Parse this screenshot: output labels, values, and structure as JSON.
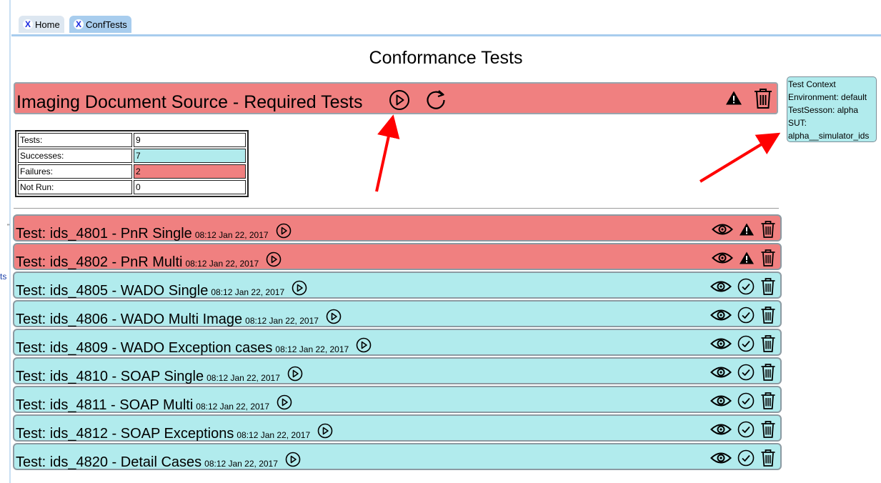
{
  "edge": {
    "mark1": "\"",
    "mark2": "ts"
  },
  "tabs": [
    {
      "label": "Home",
      "close": "X"
    },
    {
      "label": "ConfTests",
      "close": "X"
    }
  ],
  "page_title": "Conformance Tests",
  "suite": {
    "title": "Imaging Document Source - Required Tests",
    "status": "fail"
  },
  "context": {
    "title": "Test Context",
    "environment": "Environment: default",
    "session": "TestSesson: alpha",
    "sut_label": "SUT:",
    "sut_value": "alpha__simulator_ids"
  },
  "stats": {
    "tests_label": "Tests:",
    "tests": "9",
    "successes_label": "Successes:",
    "successes": "7",
    "failures_label": "Failures:",
    "failures": "2",
    "notrun_label": "Not Run:",
    "notrun": "0"
  },
  "colors": {
    "fail": "#f08080",
    "pass": "#b1ebed",
    "accent": "#a8cdee",
    "arrow": "#ff0000"
  },
  "tests": [
    {
      "title": "Test: ids_4801 - PnR Single",
      "time": "08:12 Jan 22, 2017",
      "status": "fail",
      "status_icon": "warning-icon"
    },
    {
      "title": "Test: ids_4802 - PnR Multi",
      "time": "08:12 Jan 22, 2017",
      "status": "fail",
      "status_icon": "warning-icon"
    },
    {
      "title": "Test: ids_4805 - WADO Single",
      "time": "08:12 Jan 22, 2017",
      "status": "pass",
      "status_icon": "check-circle-icon"
    },
    {
      "title": "Test: ids_4806 - WADO Multi Image",
      "time": "08:12 Jan 22, 2017",
      "status": "pass",
      "status_icon": "check-circle-icon"
    },
    {
      "title": "Test: ids_4809 - WADO Exception cases",
      "time": "08:12 Jan 22, 2017",
      "status": "pass",
      "status_icon": "check-circle-icon"
    },
    {
      "title": "Test: ids_4810 - SOAP Single",
      "time": "08:12 Jan 22, 2017",
      "status": "pass",
      "status_icon": "check-circle-icon"
    },
    {
      "title": "Test: ids_4811 - SOAP Multi",
      "time": "08:12 Jan 22, 2017",
      "status": "pass",
      "status_icon": "check-circle-icon"
    },
    {
      "title": "Test: ids_4812 - SOAP Exceptions",
      "time": "08:12 Jan 22, 2017",
      "status": "pass",
      "status_icon": "check-circle-icon"
    },
    {
      "title": "Test: ids_4820 - Detail Cases",
      "time": "08:12 Jan 22, 2017",
      "status": "pass",
      "status_icon": "check-circle-icon"
    }
  ]
}
